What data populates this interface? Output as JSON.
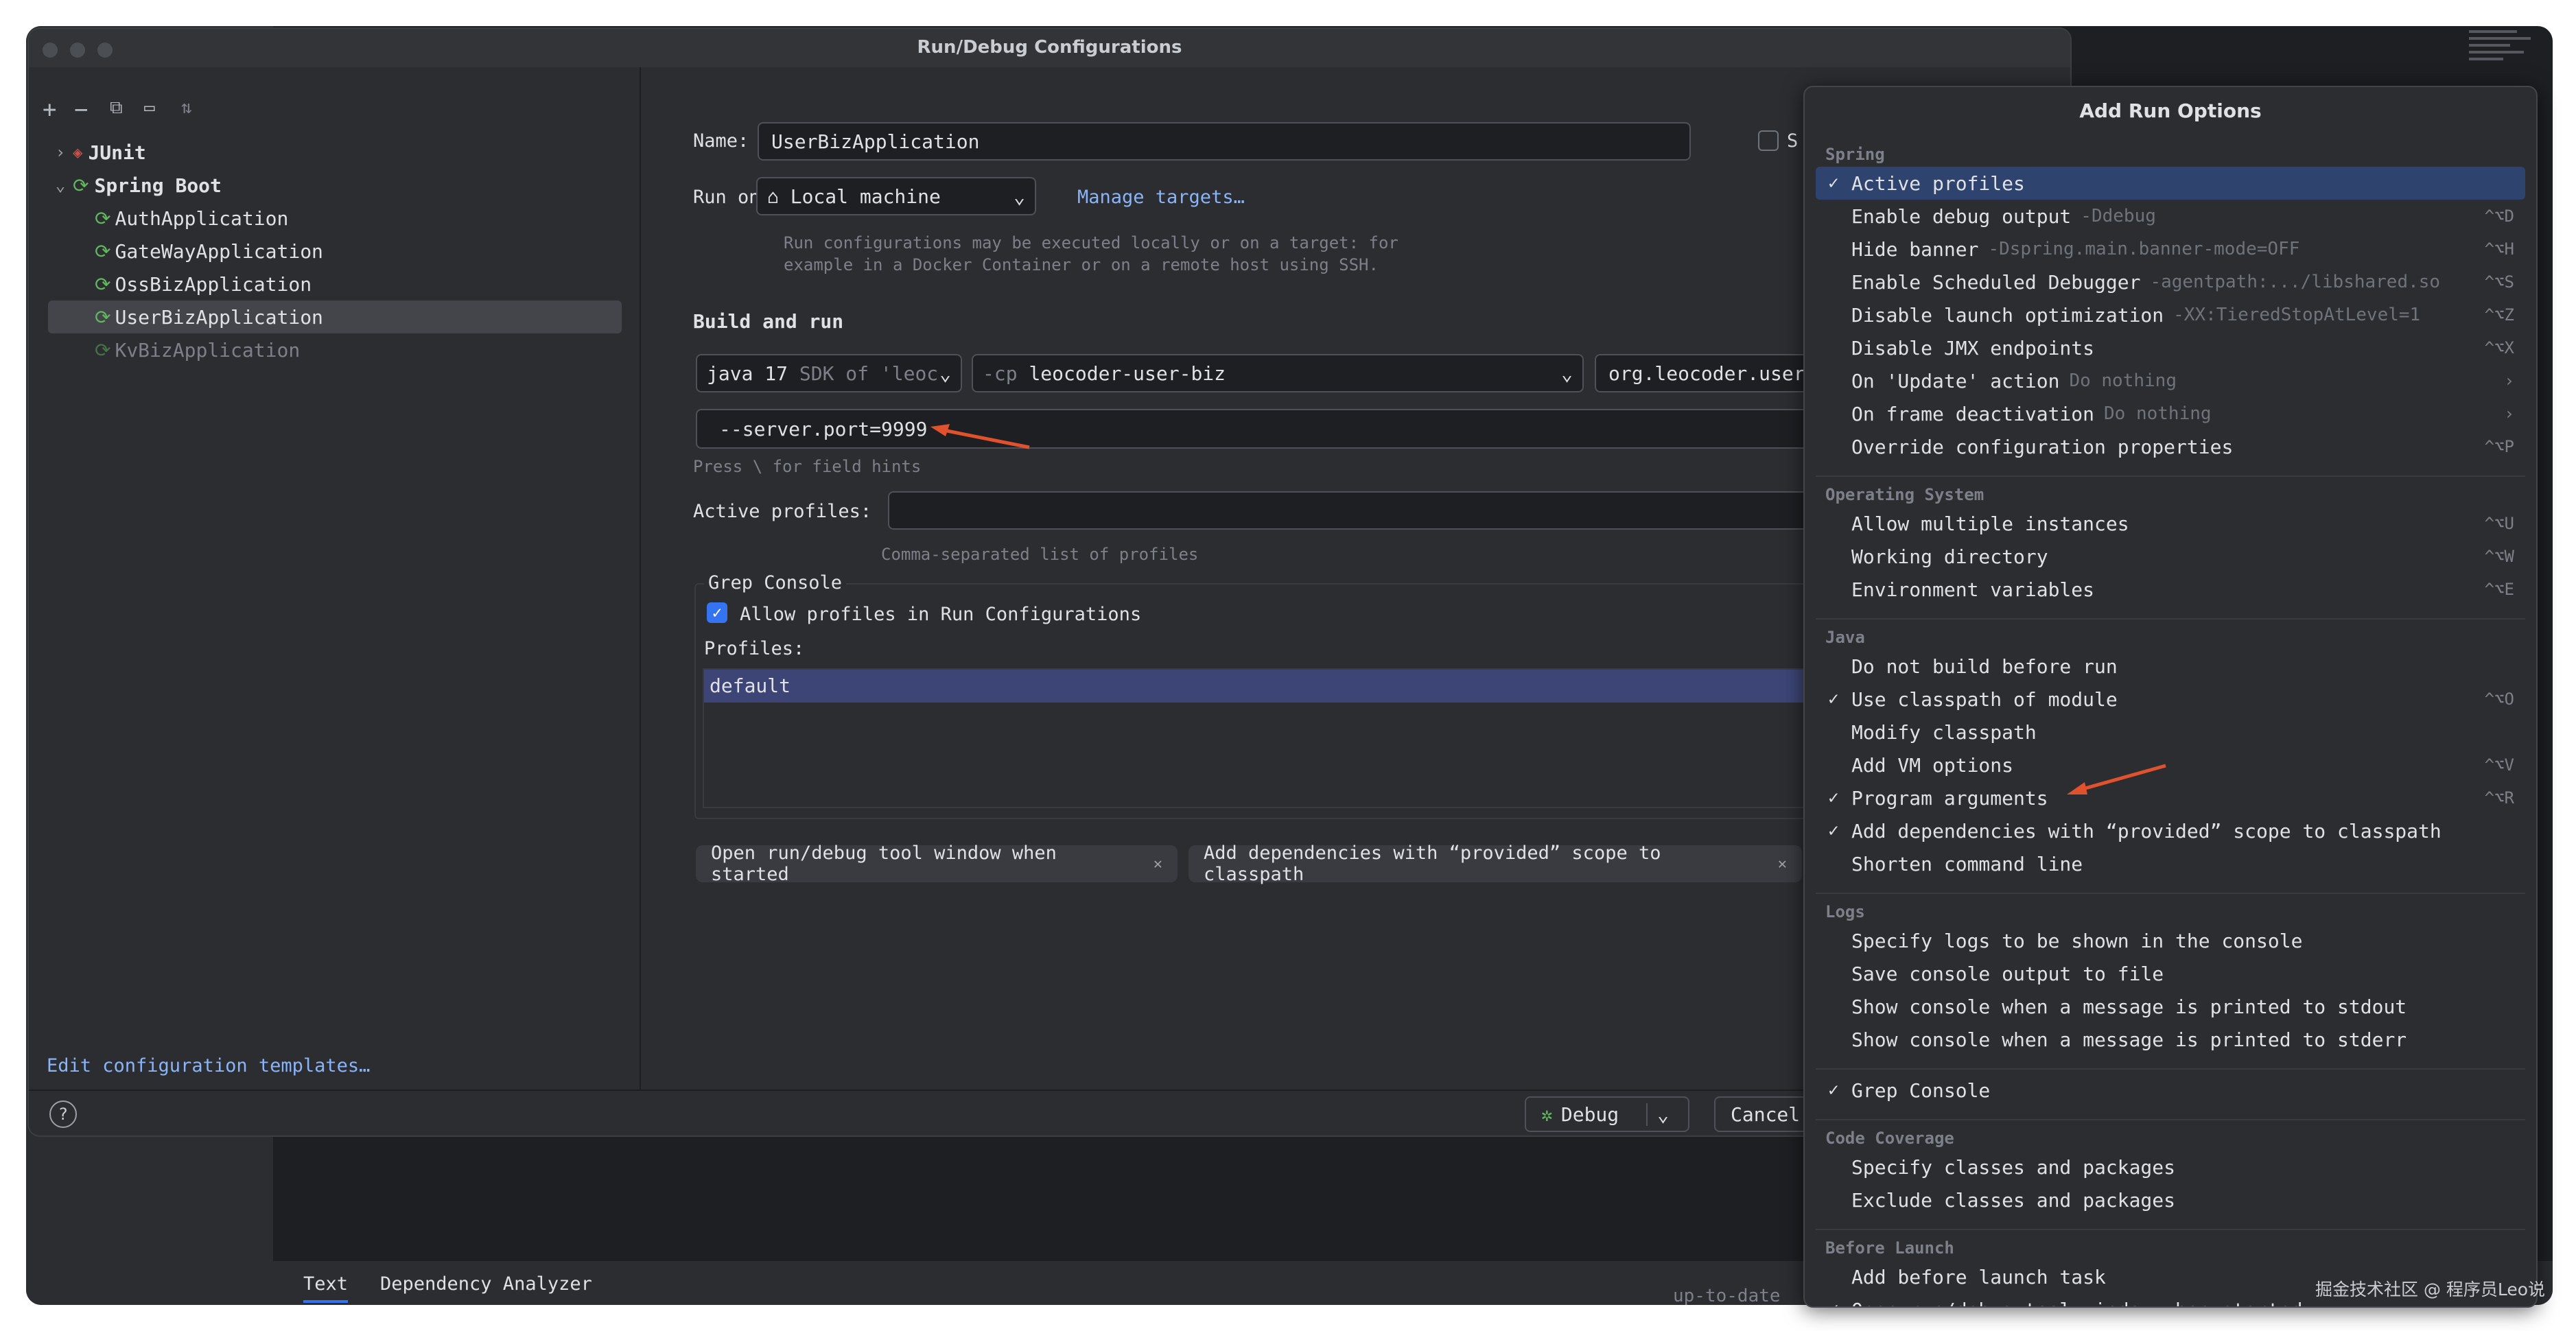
{
  "window": {
    "title": "Run/Debug Configurations"
  },
  "background_ide": {
    "tabs": [
      "Text",
      "Dependency Analyzer"
    ],
    "status_text": "up-to-date"
  },
  "tree": {
    "groups": [
      {
        "label": "JUnit",
        "icon": "junit-icon",
        "expanded": false
      },
      {
        "label": "Spring Boot",
        "icon": "spring-boot-icon",
        "expanded": true
      }
    ],
    "items": [
      {
        "label": "AuthApplication",
        "selected": false,
        "dim": false
      },
      {
        "label": "GateWayApplication",
        "selected": false,
        "dim": false
      },
      {
        "label": "OssBizApplication",
        "selected": false,
        "dim": false
      },
      {
        "label": "UserBizApplication",
        "selected": true,
        "dim": false
      },
      {
        "label": "KvBizApplication",
        "selected": false,
        "dim": true
      }
    ],
    "edit_templates_link": "Edit configuration templates…"
  },
  "form": {
    "name_label": "Name:",
    "name_value": "UserBizApplication",
    "store_checkbox_label": "S",
    "run_on_label": "Run on:",
    "run_on_value": "Local machine",
    "manage_targets": "Manage targets…",
    "run_on_hint_1": "Run configurations may be executed locally or on a target: for",
    "run_on_hint_2": "example in a Docker Container or on a remote host using SSH.",
    "build_and_run": "Build and run",
    "jdk_value": "java 17",
    "jdk_sub": "SDK of 'leoc",
    "cp_prefix": "-cp",
    "cp_value": "leocoder-user-biz",
    "main_class": "org.leocoder.user.biz",
    "program_args": "--server.port=9999",
    "field_hint": "Press \\ for field hints",
    "active_profiles_label": "Active profiles:",
    "active_profiles_hint": "Comma-separated list of profiles",
    "grep_console_title": "Grep Console",
    "allow_profiles_label": "Allow profiles in Run Configurations",
    "profiles_label": "Profiles:",
    "profiles": [
      "default"
    ],
    "chips": [
      "Open run/debug tool window when started",
      "Add dependencies with “provided” scope to classpath"
    ]
  },
  "footer": {
    "help": "?",
    "debug_label": "Debug",
    "cancel_label": "Cancel"
  },
  "popup": {
    "title": "Add Run Options",
    "groups": [
      {
        "name": "Spring",
        "options": [
          {
            "label": "Active profiles",
            "sub": "",
            "shortcut": "",
            "checked": true,
            "selected": true,
            "submenu": false
          },
          {
            "label": "Enable debug output",
            "sub": "-Ddebug",
            "shortcut": "^⌥D",
            "checked": false,
            "selected": false,
            "submenu": false
          },
          {
            "label": "Hide banner",
            "sub": "-Dspring.main.banner-mode=OFF",
            "shortcut": "^⌥H",
            "checked": false,
            "selected": false,
            "submenu": false
          },
          {
            "label": "Enable Scheduled Debugger",
            "sub": "-agentpath:.../libshared.so",
            "shortcut": "^⌥S",
            "checked": false,
            "selected": false,
            "submenu": false
          },
          {
            "label": "Disable launch optimization",
            "sub": "-XX:TieredStopAtLevel=1",
            "shortcut": "^⌥Z",
            "checked": false,
            "selected": false,
            "submenu": false
          },
          {
            "label": "Disable JMX endpoints",
            "sub": "",
            "shortcut": "^⌥X",
            "checked": false,
            "selected": false,
            "submenu": false
          },
          {
            "label": "On 'Update' action",
            "sub": "Do nothing",
            "shortcut": "",
            "checked": false,
            "selected": false,
            "submenu": true
          },
          {
            "label": "On frame deactivation",
            "sub": "Do nothing",
            "shortcut": "",
            "checked": false,
            "selected": false,
            "submenu": true
          },
          {
            "label": "Override configuration properties",
            "sub": "",
            "shortcut": "^⌥P",
            "checked": false,
            "selected": false,
            "submenu": false
          }
        ]
      },
      {
        "name": "Operating System",
        "options": [
          {
            "label": "Allow multiple instances",
            "sub": "",
            "shortcut": "^⌥U",
            "checked": false,
            "selected": false,
            "submenu": false
          },
          {
            "label": "Working directory",
            "sub": "",
            "shortcut": "^⌥W",
            "checked": false,
            "selected": false,
            "submenu": false
          },
          {
            "label": "Environment variables",
            "sub": "",
            "shortcut": "^⌥E",
            "checked": false,
            "selected": false,
            "submenu": false
          }
        ]
      },
      {
        "name": "Java",
        "options": [
          {
            "label": "Do not build before run",
            "sub": "",
            "shortcut": "",
            "checked": false,
            "selected": false,
            "submenu": false
          },
          {
            "label": "Use classpath of module",
            "sub": "",
            "shortcut": "^⌥O",
            "checked": true,
            "selected": false,
            "submenu": false
          },
          {
            "label": "Modify classpath",
            "sub": "",
            "shortcut": "",
            "checked": false,
            "selected": false,
            "submenu": false
          },
          {
            "label": "Add VM options",
            "sub": "",
            "shortcut": "^⌥V",
            "checked": false,
            "selected": false,
            "submenu": false
          },
          {
            "label": "Program arguments",
            "sub": "",
            "shortcut": "^⌥R",
            "checked": true,
            "selected": false,
            "submenu": false
          },
          {
            "label": "Add dependencies with “provided” scope to classpath",
            "sub": "",
            "shortcut": "",
            "checked": true,
            "selected": false,
            "submenu": false
          },
          {
            "label": "Shorten command line",
            "sub": "",
            "shortcut": "",
            "checked": false,
            "selected": false,
            "submenu": false
          }
        ]
      },
      {
        "name": "Logs",
        "options": [
          {
            "label": "Specify logs to be shown in the console",
            "sub": "",
            "shortcut": "",
            "checked": false,
            "selected": false,
            "submenu": false
          },
          {
            "label": "Save console output to file",
            "sub": "",
            "shortcut": "",
            "checked": false,
            "selected": false,
            "submenu": false
          },
          {
            "label": "Show console when a message is printed to stdout",
            "sub": "",
            "shortcut": "",
            "checked": false,
            "selected": false,
            "submenu": false
          },
          {
            "label": "Show console when a message is printed to stderr",
            "sub": "",
            "shortcut": "",
            "checked": false,
            "selected": false,
            "submenu": false
          }
        ]
      },
      {
        "name": "",
        "options": [
          {
            "label": "Grep Console",
            "sub": "",
            "shortcut": "",
            "checked": true,
            "selected": false,
            "submenu": false
          }
        ]
      },
      {
        "name": "Code Coverage",
        "options": [
          {
            "label": "Specify classes and packages",
            "sub": "",
            "shortcut": "",
            "checked": false,
            "selected": false,
            "submenu": false
          },
          {
            "label": "Exclude classes and packages",
            "sub": "",
            "shortcut": "",
            "checked": false,
            "selected": false,
            "submenu": false
          }
        ]
      },
      {
        "name": "Before Launch",
        "options": [
          {
            "label": "Add before launch task",
            "sub": "",
            "shortcut": "",
            "checked": false,
            "selected": false,
            "submenu": false
          },
          {
            "label": "Open run/debug tool window when started",
            "sub": "",
            "shortcut": "",
            "checked": true,
            "selected": false,
            "submenu": false
          }
        ]
      }
    ]
  },
  "watermark": "掘金技术社区 @ 程序员Leo说",
  "colors": {
    "accent": "#3574f0",
    "selection": "#2e436e",
    "annotation_arrow": "#e0522d",
    "spring_green": "#5fb85c"
  }
}
